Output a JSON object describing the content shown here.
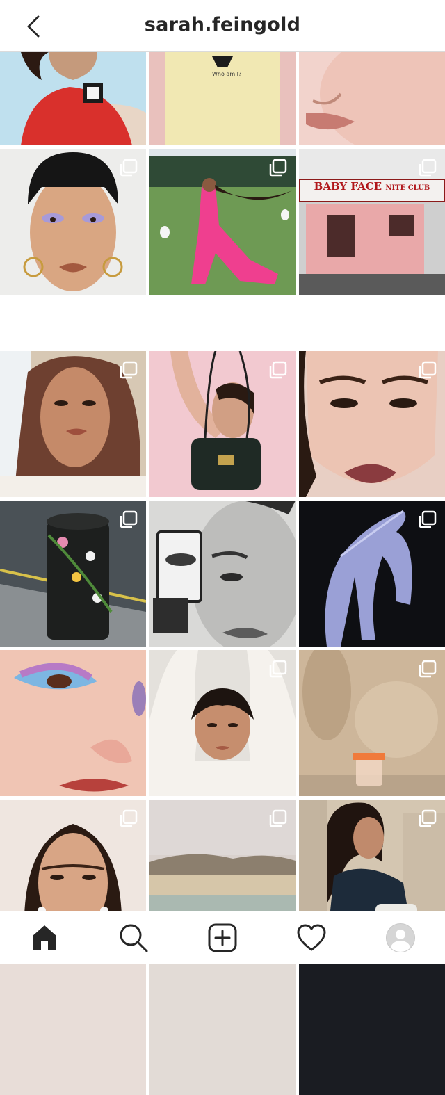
{
  "header": {
    "username": "sarah.feingold",
    "back_icon": "chevron-left-icon"
  },
  "grid": {
    "sign_text_line1": "BABY FACE",
    "sign_text_line2": "NITE CLUB",
    "shirt_text": "Who am I?",
    "multi_icon": "carousel-icon"
  },
  "nav": {
    "items": [
      {
        "icon": "home-icon"
      },
      {
        "icon": "search-icon"
      },
      {
        "icon": "add-post-icon"
      },
      {
        "icon": "heart-icon"
      },
      {
        "icon": "profile-avatar"
      }
    ]
  },
  "colors": {
    "text": "#262626",
    "divider": "#dbdbdb"
  }
}
